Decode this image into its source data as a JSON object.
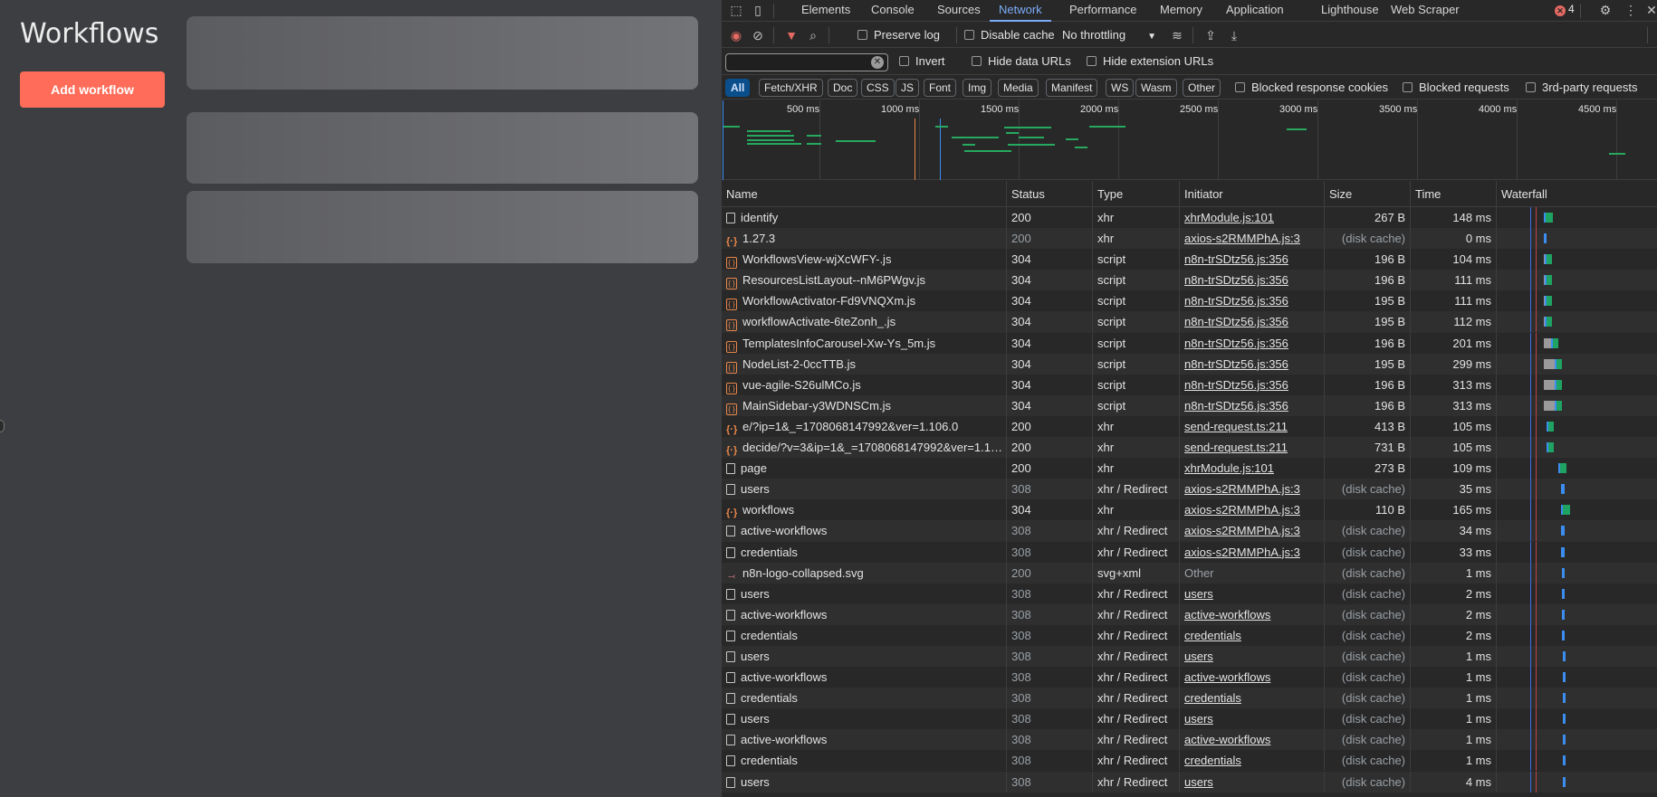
{
  "app": {
    "title": "Workflows",
    "add_button": "Add workflow"
  },
  "devtools": {
    "tabs": [
      "Elements",
      "Console",
      "Sources",
      "Network",
      "Performance",
      "Memory",
      "Application",
      "Lighthouse",
      "Web Scraper"
    ],
    "active_tab": "Network",
    "error_count": "4",
    "toolbar": {
      "preserve_log": "Preserve log",
      "disable_cache": "Disable cache",
      "throttling": "No throttling"
    },
    "filter": {
      "value": "",
      "invert": "Invert",
      "hide_data_urls": "Hide data URLs",
      "hide_extension_urls": "Hide extension URLs"
    },
    "type_filters": [
      "All",
      "Fetch/XHR",
      "Doc",
      "CSS",
      "JS",
      "Font",
      "Img",
      "Media",
      "Manifest",
      "WS",
      "Wasm",
      "Other"
    ],
    "extra_filters": {
      "blocked_response_cookies": "Blocked response cookies",
      "blocked_requests": "Blocked requests",
      "third_party": "3rd-party requests"
    },
    "overview_ticks": [
      "500 ms",
      "1000 ms",
      "1500 ms",
      "2000 ms",
      "2500 ms",
      "3000 ms",
      "3500 ms",
      "4000 ms",
      "4500 ms"
    ],
    "columns": {
      "name": "Name",
      "status": "Status",
      "type": "Type",
      "initiator": "Initiator",
      "size": "Size",
      "time": "Time",
      "waterfall": "Waterfall"
    },
    "requests": [
      {
        "name": "identify",
        "icon": "doc",
        "status": "200",
        "type": "xhr",
        "initiator": "xhrModule.js:101",
        "size": "267 B",
        "time": "148 ms",
        "muted": false,
        "wf": [
          0,
          0,
          8
        ]
      },
      {
        "name": "1.27.3",
        "icon": "json",
        "status": "200",
        "type": "xhr",
        "initiator": "axios-s2RMMPhA.js:3",
        "size": "(disk cache)",
        "time": "0 ms",
        "muted": true,
        "wf": [
          0,
          0,
          3,
          "b"
        ]
      },
      {
        "name": "WorkflowsView-wjXcWFY-.js",
        "icon": "script",
        "status": "304",
        "type": "script",
        "initiator": "n8n-trSDtz56.js:356",
        "size": "196 B",
        "time": "104 ms",
        "muted": false,
        "wf": [
          0,
          1,
          6
        ]
      },
      {
        "name": "ResourcesListLayout--nM6PWgv.js",
        "icon": "script",
        "status": "304",
        "type": "script",
        "initiator": "n8n-trSDtz56.js:356",
        "size": "196 B",
        "time": "111 ms",
        "muted": false,
        "wf": [
          0,
          1,
          6
        ]
      },
      {
        "name": "WorkflowActivator-Fd9VNQXm.js",
        "icon": "script",
        "status": "304",
        "type": "script",
        "initiator": "n8n-trSDtz56.js:356",
        "size": "195 B",
        "time": "111 ms",
        "muted": false,
        "wf": [
          0,
          1,
          6
        ]
      },
      {
        "name": "workflowActivate-6teZonh_.js",
        "icon": "script",
        "status": "304",
        "type": "script",
        "initiator": "n8n-trSDtz56.js:356",
        "size": "195 B",
        "time": "112 ms",
        "muted": false,
        "wf": [
          0,
          1,
          6
        ]
      },
      {
        "name": "TemplatesInfoCarousel-Xw-Ys_5m.js",
        "icon": "script",
        "status": "304",
        "type": "script",
        "initiator": "n8n-trSDtz56.js:356",
        "size": "196 B",
        "time": "201 ms",
        "muted": false,
        "wf": [
          0,
          8,
          6
        ]
      },
      {
        "name": "NodeList-2-0ccTTB.js",
        "icon": "script",
        "status": "304",
        "type": "script",
        "initiator": "n8n-trSDtz56.js:356",
        "size": "195 B",
        "time": "299 ms",
        "muted": false,
        "wf": [
          0,
          12,
          6
        ]
      },
      {
        "name": "vue-agile-S26ulMCo.js",
        "icon": "script",
        "status": "304",
        "type": "script",
        "initiator": "n8n-trSDtz56.js:356",
        "size": "196 B",
        "time": "313 ms",
        "muted": false,
        "wf": [
          0,
          12,
          6
        ]
      },
      {
        "name": "MainSidebar-y3WDNSCm.js",
        "icon": "script",
        "status": "304",
        "type": "script",
        "initiator": "n8n-trSDtz56.js:356",
        "size": "196 B",
        "time": "313 ms",
        "muted": false,
        "wf": [
          0,
          12,
          6
        ]
      },
      {
        "name": "e/?ip=1&_=1708068147992&ver=1.106.0",
        "icon": "json",
        "status": "200",
        "type": "xhr",
        "initiator": "send-request.ts:211",
        "size": "413 B",
        "time": "105 ms",
        "muted": false,
        "wf": [
          3,
          0,
          6
        ]
      },
      {
        "name": "decide/?v=3&ip=1&_=1708068147992&ver=1.106.0",
        "icon": "json",
        "status": "200",
        "type": "xhr",
        "initiator": "send-request.ts:211",
        "size": "731 B",
        "time": "105 ms",
        "muted": false,
        "wf": [
          3,
          0,
          6
        ]
      },
      {
        "name": "page",
        "icon": "doc",
        "status": "200",
        "type": "xhr",
        "initiator": "xhrModule.js:101",
        "size": "273 B",
        "time": "109 ms",
        "muted": false,
        "wf": [
          16,
          0,
          7
        ]
      },
      {
        "name": "users",
        "icon": "doc",
        "status": "308",
        "type": "xhr / Redirect",
        "initiator": "axios-s2RMMPhA.js:3",
        "size": "(disk cache)",
        "time": "35 ms",
        "muted": true,
        "wf": [
          19,
          0,
          4,
          "b"
        ]
      },
      {
        "name": "workflows",
        "icon": "json",
        "status": "304",
        "type": "xhr",
        "initiator": "axios-s2RMMPhA.js:3",
        "size": "110 B",
        "time": "165 ms",
        "muted": false,
        "wf": [
          19,
          0,
          8
        ]
      },
      {
        "name": "active-workflows",
        "icon": "doc",
        "status": "308",
        "type": "xhr / Redirect",
        "initiator": "axios-s2RMMPhA.js:3",
        "size": "(disk cache)",
        "time": "34 ms",
        "muted": true,
        "wf": [
          19,
          0,
          4,
          "b"
        ]
      },
      {
        "name": "credentials",
        "icon": "doc",
        "status": "308",
        "type": "xhr / Redirect",
        "initiator": "axios-s2RMMPhA.js:3",
        "size": "(disk cache)",
        "time": "33 ms",
        "muted": true,
        "wf": [
          19,
          0,
          4,
          "b"
        ]
      },
      {
        "name": "n8n-logo-collapsed.svg",
        "icon": "svg",
        "status": "200",
        "type": "svg+xml",
        "initiator": "Other",
        "size": "(disk cache)",
        "time": "1 ms",
        "muted": true,
        "wf": [
          20,
          0,
          3,
          "b"
        ]
      },
      {
        "name": "users",
        "icon": "doc",
        "status": "308",
        "type": "xhr / Redirect",
        "initiator": "users",
        "size": "(disk cache)",
        "time": "2 ms",
        "muted": true,
        "wf": [
          20,
          0,
          3,
          "b"
        ]
      },
      {
        "name": "active-workflows",
        "icon": "doc",
        "status": "308",
        "type": "xhr / Redirect",
        "initiator": "active-workflows",
        "size": "(disk cache)",
        "time": "2 ms",
        "muted": true,
        "wf": [
          20,
          0,
          3,
          "b"
        ]
      },
      {
        "name": "credentials",
        "icon": "doc",
        "status": "308",
        "type": "xhr / Redirect",
        "initiator": "credentials",
        "size": "(disk cache)",
        "time": "2 ms",
        "muted": true,
        "wf": [
          20,
          0,
          3,
          "b"
        ]
      },
      {
        "name": "users",
        "icon": "doc",
        "status": "308",
        "type": "xhr / Redirect",
        "initiator": "users",
        "size": "(disk cache)",
        "time": "1 ms",
        "muted": true,
        "wf": [
          21,
          0,
          3,
          "b"
        ]
      },
      {
        "name": "active-workflows",
        "icon": "doc",
        "status": "308",
        "type": "xhr / Redirect",
        "initiator": "active-workflows",
        "size": "(disk cache)",
        "time": "1 ms",
        "muted": true,
        "wf": [
          21,
          0,
          3,
          "b"
        ]
      },
      {
        "name": "credentials",
        "icon": "doc",
        "status": "308",
        "type": "xhr / Redirect",
        "initiator": "credentials",
        "size": "(disk cache)",
        "time": "1 ms",
        "muted": true,
        "wf": [
          21,
          0,
          3,
          "b"
        ]
      },
      {
        "name": "users",
        "icon": "doc",
        "status": "308",
        "type": "xhr / Redirect",
        "initiator": "users",
        "size": "(disk cache)",
        "time": "1 ms",
        "muted": true,
        "wf": [
          21,
          0,
          3,
          "b"
        ]
      },
      {
        "name": "active-workflows",
        "icon": "doc",
        "status": "308",
        "type": "xhr / Redirect",
        "initiator": "active-workflows",
        "size": "(disk cache)",
        "time": "1 ms",
        "muted": true,
        "wf": [
          21,
          0,
          3,
          "b"
        ]
      },
      {
        "name": "credentials",
        "icon": "doc",
        "status": "308",
        "type": "xhr / Redirect",
        "initiator": "credentials",
        "size": "(disk cache)",
        "time": "1 ms",
        "muted": true,
        "wf": [
          21,
          0,
          3,
          "b"
        ]
      },
      {
        "name": "users",
        "icon": "doc",
        "status": "308",
        "type": "xhr / Redirect",
        "initiator": "users",
        "size": "(disk cache)",
        "time": "4 ms",
        "muted": true,
        "wf": [
          21,
          0,
          3,
          "b"
        ]
      }
    ],
    "colors": {
      "accent": "#7cacf8",
      "add_button": "#ff6d5a",
      "waterfall_receive": "#1ea362",
      "waterfall_cache": "#3b8df0"
    }
  }
}
